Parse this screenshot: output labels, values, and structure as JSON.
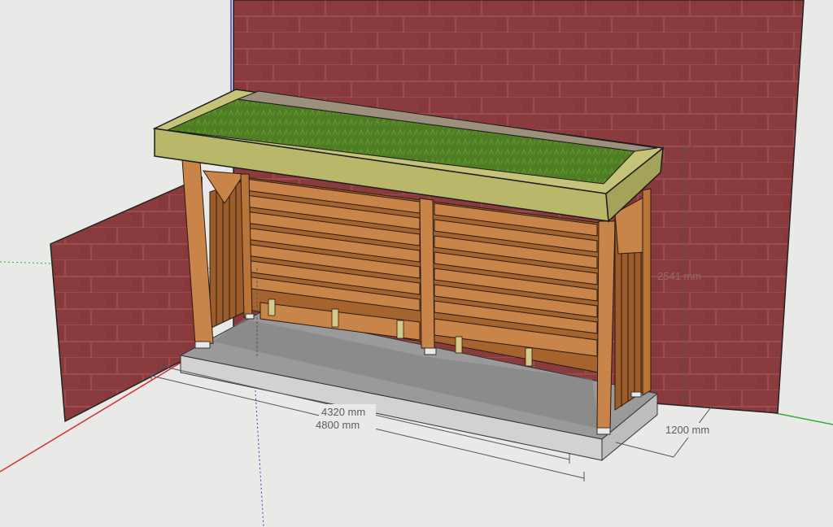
{
  "viewport": {
    "background": "#e9e9e7",
    "colors": {
      "brick_wall": "#8a3b3e",
      "brick_mortar": "#a05558",
      "green_roof": "#4d7b22",
      "timber": "#c98549",
      "timber_dark": "#8c5426",
      "roof_fascia": "#b9b86a",
      "concrete_slab": "#cfcfcf",
      "axis_red": "#d23030",
      "axis_green": "#2fae37",
      "axis_blue": "#3a3ad0"
    }
  },
  "dimensions": {
    "inner_width": "4320 mm",
    "outer_width": "4800 mm",
    "depth": "1200 mm",
    "height": "2541 mm"
  }
}
